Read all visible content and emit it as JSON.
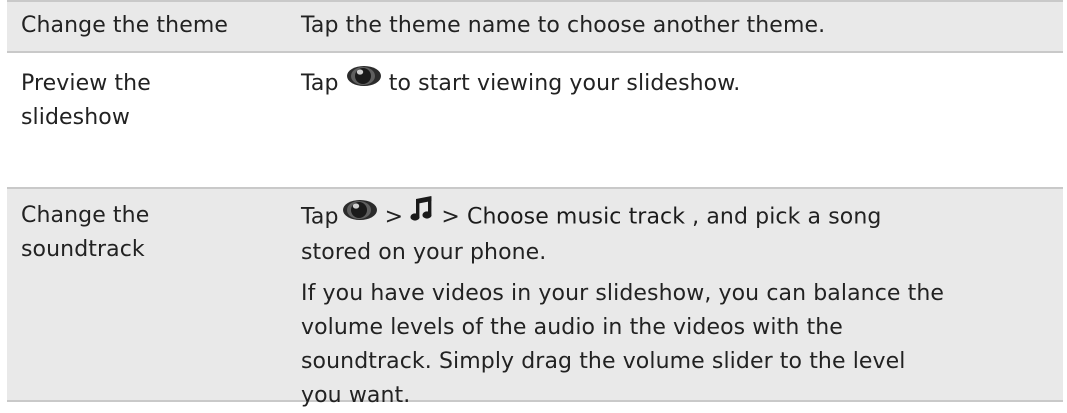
{
  "rows": [
    {
      "action": "Change the theme",
      "desc": "Tap the theme name to choose another theme."
    },
    {
      "action_line1": "Preview the",
      "action_line2": "slideshow",
      "desc_before": "Tap ",
      "desc_after": " to start viewing your slideshow."
    },
    {
      "action_line1": "Change the",
      "action_line2": "soundtrack",
      "desc_tap": "Tap",
      "desc_sep1": " > ",
      "desc_sep2": " > ",
      "desc_term": "Choose music track",
      "desc_tail": " , and pick a song",
      "desc_line2": "stored on your phone.",
      "para2_lines": [
        "If you have videos in your slideshow, you can balance the",
        "volume levels of the audio in the videos with the",
        "soundtrack. Simply drag the volume slider to the level",
        "you want."
      ]
    }
  ],
  "icons": {
    "preview": "eye-icon",
    "music": "music-note-icon"
  },
  "colors": {
    "row_shade": "#e9e9e9",
    "rule": "#c9c9c9",
    "text": "#222222"
  }
}
